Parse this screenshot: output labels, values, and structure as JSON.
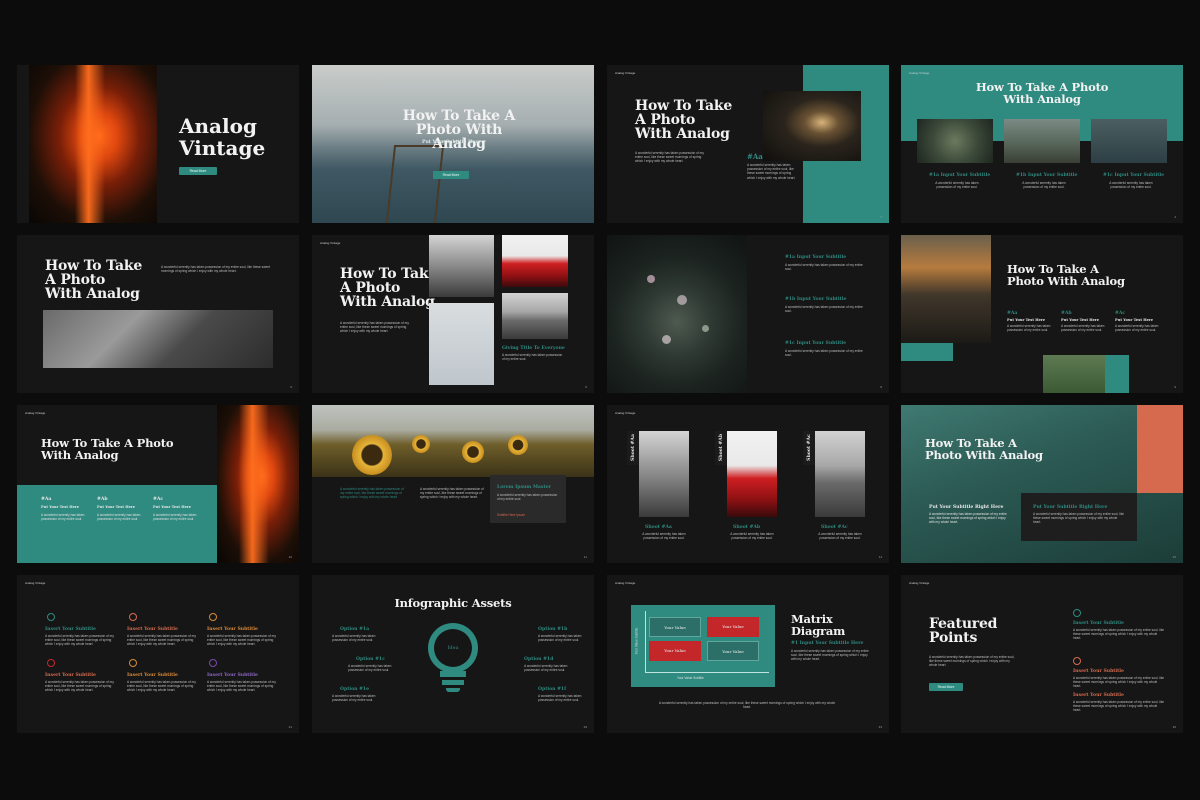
{
  "brand": "Analog Vintage",
  "common": {
    "how_to": "How To Take A Photo With Analog",
    "your_subtitle": "Put Your Subtitle Here",
    "your_text": "Put Your Text Here",
    "insert_subtitle": "Insert Your Subtitle",
    "lorem": "A wonderful serenity has taken possession of my entire soul, like these sweet mornings of spring which I enjoy with my whole heart.",
    "lorem_short": "A wonderful serenity has taken possession of my entire soul.",
    "read_more": "Read More"
  },
  "slides": {
    "s1": {
      "title_line1": "Analog",
      "title_line2": "Vintage",
      "button": "Read More"
    },
    "s2": {
      "title_line1": "How To Take A",
      "title_line2": "Photo With Analog",
      "subtitle": "Put Your Subtitle Here",
      "button": "Read More"
    },
    "s3": {
      "title_line1": "How To Take",
      "title_line2": "A Photo",
      "title_line3": "With Analog",
      "tag": "#Aa",
      "page": "3"
    },
    "s4": {
      "title_line1": "How To Take A Photo",
      "title_line2": "With Analog",
      "labels": [
        "#1a Input Your Subtitle",
        "#1b Input Your Subtitle",
        "#1c Input Your Subtitle"
      ],
      "page": "4"
    },
    "s5": {
      "title_line1": "How To Take",
      "title_line2": "A Photo",
      "title_line3": "With Analog",
      "page": "5"
    },
    "s6": {
      "title_line1": "How To Take",
      "title_line2": "A Photo",
      "title_line3": "With Analog",
      "caption": "Giving Title To Everyone",
      "page": "6"
    },
    "s7": {
      "labels": [
        "#1a Input Your Subtitle",
        "#1b Input Your Subtitle",
        "#1c Input Your Subtitle"
      ],
      "page": "8"
    },
    "s8": {
      "title_line1": "How To Take A",
      "title_line2": "Photo With Analog",
      "tags": [
        "#Aa",
        "#Ab",
        "#Ac"
      ],
      "page": "9"
    },
    "s9": {
      "title_line1": "How To Take A Photo",
      "title_line2": "With Analog",
      "tags": [
        "#Aa",
        "#Ab",
        "#Ac"
      ],
      "page": "10"
    },
    "s10": {
      "box_title": "Lorem Ipsum Master",
      "box_sub": "Subtitle Here Ipsum",
      "page": "11"
    },
    "s11": {
      "vertical": [
        "Shoot #Aa",
        "Shoot #Ab",
        "Shoot #Ac"
      ],
      "labels": [
        "Shoot #Aa",
        "Shoot #Ab",
        "Shoot #Ac"
      ],
      "page": "14"
    },
    "s12": {
      "title_line1": "How To Take A",
      "title_line2": "Photo With Analog",
      "left_sub": "Put Your Subtitle Right Here",
      "right_sub": "Put Your Subtitle Right Here",
      "page": "15"
    },
    "s13": {
      "labels": [
        "Insert Your Subtitle",
        "Insert Your Subtitle",
        "Insert Your Subtitle",
        "Insert Your Subtitle",
        "Insert Your Subtitle",
        "Insert Your Subtitle"
      ],
      "page": "21"
    },
    "s14": {
      "title": "Infographic Assets",
      "center": "Idea",
      "options": [
        "Option #1a",
        "Option #1b",
        "Option #1c",
        "Option #1d",
        "Option #1e",
        "Option #1f"
      ],
      "page": "29"
    },
    "s15": {
      "title_line1": "Matrix",
      "title_line2": "Diagram",
      "sub": "#1 Input Your Subtitle Here",
      "cell": "Your Value",
      "axis_x": "Your Value Subtitle",
      "axis_y": "Your Value Subtitle",
      "page": "33"
    },
    "s16": {
      "title_line1": "Featured",
      "title_line2": "Points",
      "button": "Read More",
      "labels": [
        "Insert Your Subtitle",
        "Insert Your Subtitle",
        "Insert Your Subtitle"
      ],
      "page": "36"
    }
  },
  "colors": {
    "teal": "#2f8a80",
    "coral": "#d56a4e",
    "red": "#c4272a",
    "bg": "#161616"
  }
}
